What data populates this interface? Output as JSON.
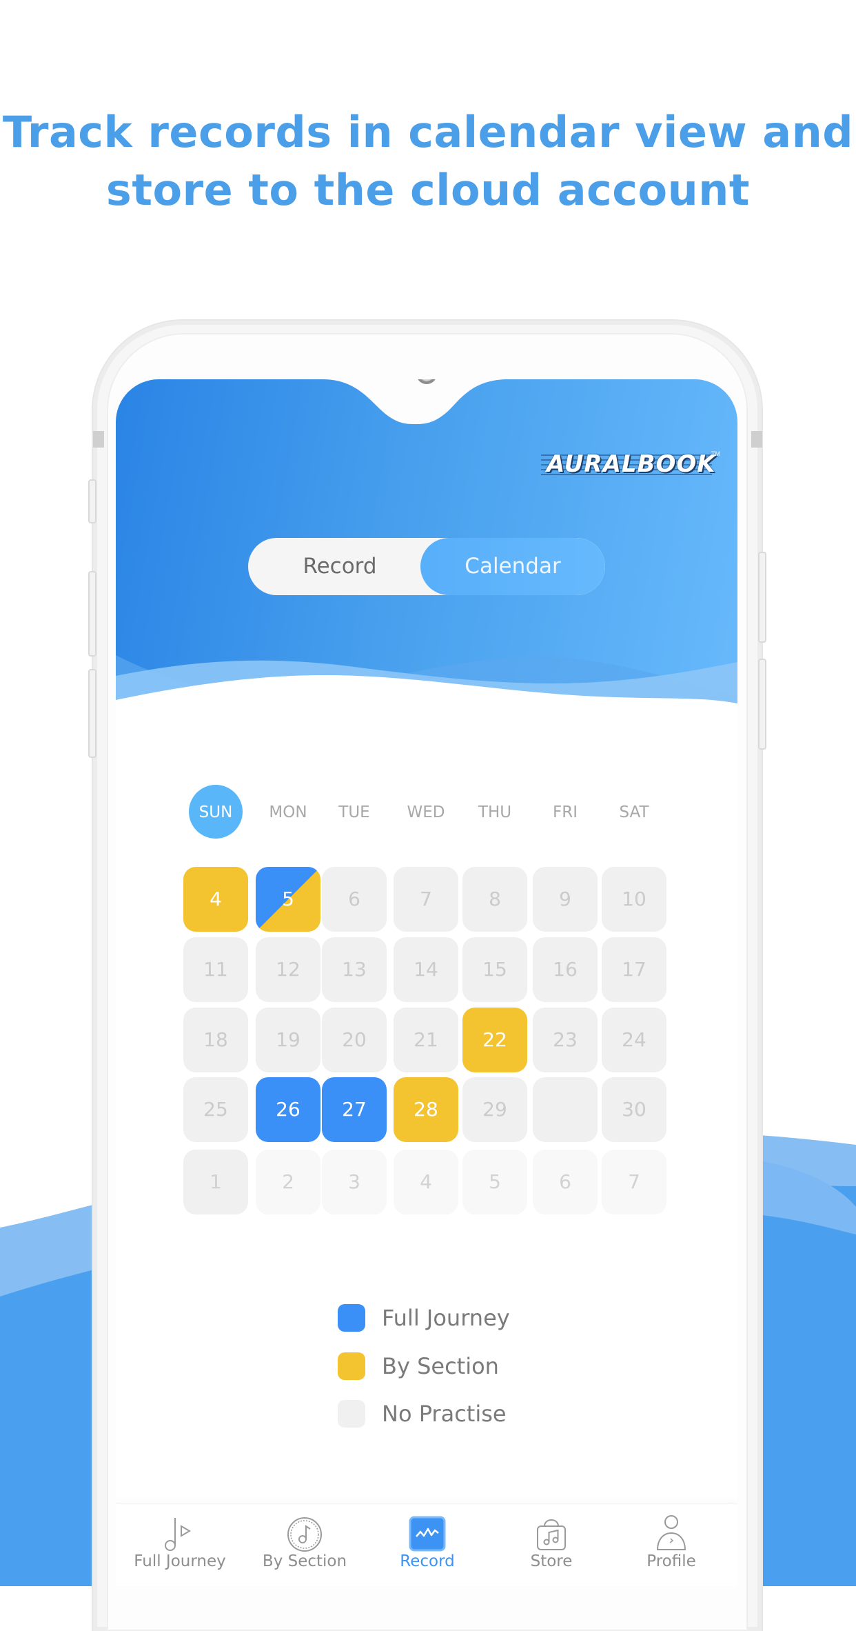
{
  "headline": {
    "line1": "Track records in calendar view and",
    "line2": "store to the cloud account"
  },
  "colors": {
    "headline": "#4a9fe8",
    "full_journey": "#3a90f7",
    "by_section": "#f4c430",
    "no_practise": "#f0f0f0",
    "accent": "#59b6f8"
  },
  "app": {
    "logo": {
      "text": "AURALBOOK",
      "tm": "TM"
    },
    "toggle": {
      "options": [
        {
          "label": "Record",
          "selected": false
        },
        {
          "label": "Calendar",
          "selected": true
        }
      ]
    },
    "calendar": {
      "weekdays": [
        {
          "label": "SUN",
          "active": true
        },
        {
          "label": "MON",
          "active": false
        },
        {
          "label": "TUE",
          "active": false
        },
        {
          "label": "WED",
          "active": false
        },
        {
          "label": "THU",
          "active": false
        },
        {
          "label": "FRI",
          "active": false
        },
        {
          "label": "SAT",
          "active": false
        }
      ],
      "weeks": [
        [
          {
            "day": "4",
            "status": "section"
          },
          {
            "day": "5",
            "status": "split"
          },
          {
            "day": "6",
            "status": "none"
          },
          {
            "day": "7",
            "status": "none"
          },
          {
            "day": "8",
            "status": "none"
          },
          {
            "day": "9",
            "status": "none"
          },
          {
            "day": "10",
            "status": "none"
          }
        ],
        [
          {
            "day": "11",
            "status": "none"
          },
          {
            "day": "12",
            "status": "none"
          },
          {
            "day": "13",
            "status": "none"
          },
          {
            "day": "14",
            "status": "none"
          },
          {
            "day": "15",
            "status": "none"
          },
          {
            "day": "16",
            "status": "none"
          },
          {
            "day": "17",
            "status": "none"
          }
        ],
        [
          {
            "day": "18",
            "status": "none"
          },
          {
            "day": "19",
            "status": "none"
          },
          {
            "day": "20",
            "status": "none"
          },
          {
            "day": "21",
            "status": "none"
          },
          {
            "day": "22",
            "status": "section"
          },
          {
            "day": "23",
            "status": "none"
          },
          {
            "day": "24",
            "status": "none"
          }
        ],
        [
          {
            "day": "25",
            "status": "none"
          },
          {
            "day": "26",
            "status": "full"
          },
          {
            "day": "27",
            "status": "full"
          },
          {
            "day": "28",
            "status": "section"
          },
          {
            "day": "29",
            "status": "none"
          },
          {
            "day": "",
            "status": "none"
          },
          {
            "day": "30",
            "status": "none"
          }
        ],
        [
          {
            "day": "1",
            "status": "next-first"
          },
          {
            "day": "2",
            "status": "next"
          },
          {
            "day": "3",
            "status": "next"
          },
          {
            "day": "4",
            "status": "next"
          },
          {
            "day": "5",
            "status": "next"
          },
          {
            "day": "6",
            "status": "next"
          },
          {
            "day": "7",
            "status": "next"
          }
        ]
      ]
    },
    "legend": [
      {
        "label": "Full Journey",
        "color": "#3a90f7"
      },
      {
        "label": "By Section",
        "color": "#f4c430"
      },
      {
        "label": "No Practise",
        "color": "#f0f0f0"
      }
    ],
    "bottom_nav": [
      {
        "label": "Full Journey",
        "icon": "note-play-icon",
        "active": false
      },
      {
        "label": "By Section",
        "icon": "note-disc-icon",
        "active": false
      },
      {
        "label": "Record",
        "icon": "waveform-chart-icon",
        "active": true
      },
      {
        "label": "Store",
        "icon": "music-bag-icon",
        "active": false
      },
      {
        "label": "Profile",
        "icon": "person-icon",
        "active": false
      }
    ]
  }
}
